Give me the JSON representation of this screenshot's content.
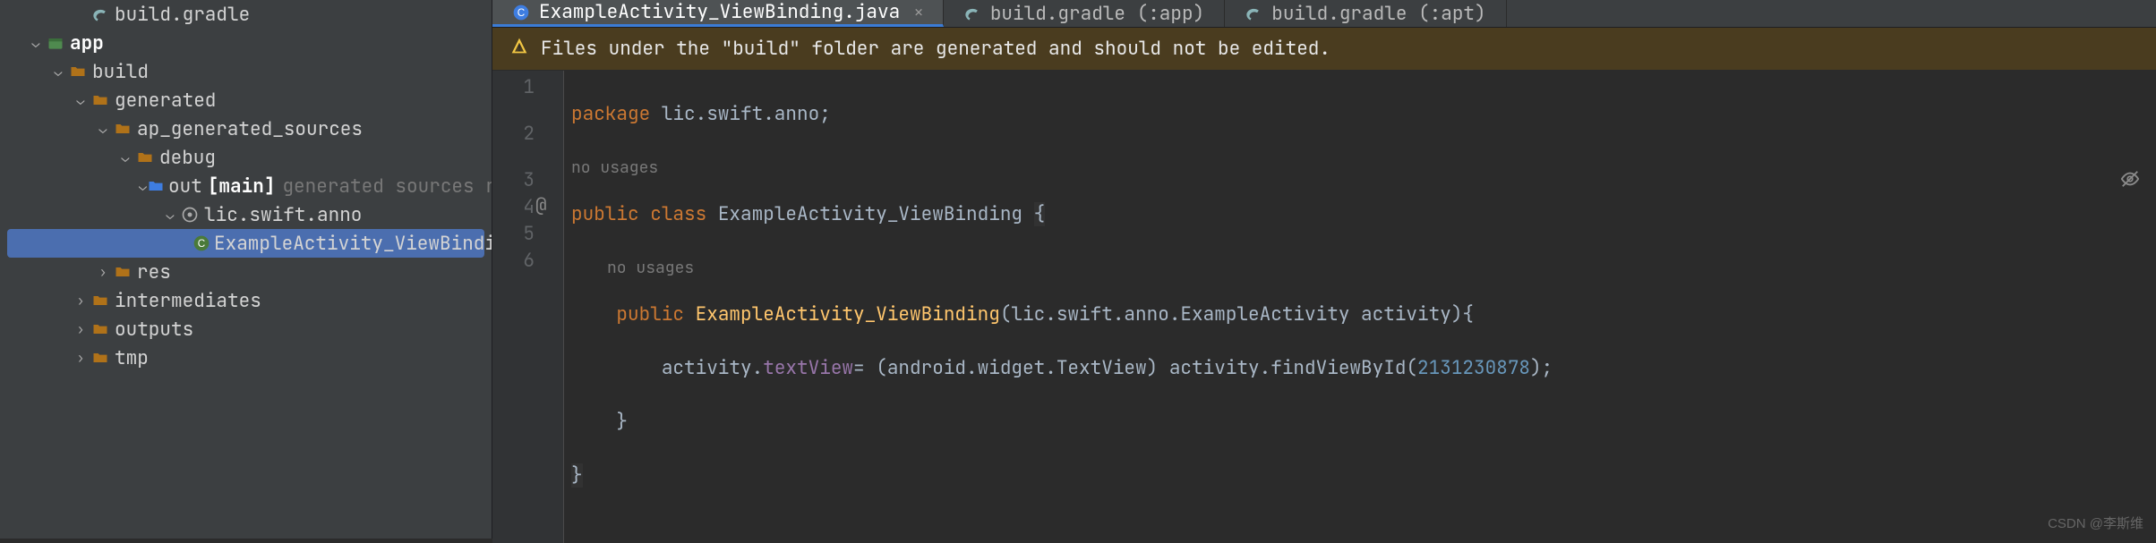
{
  "tree": {
    "n0": "build.gradle",
    "n1": "app",
    "n2": "build",
    "n3": "generated",
    "n4": "ap_generated_sources",
    "n5": "debug",
    "n6": "out",
    "n6_bold": "[main]",
    "n6_dim": "generated sources root",
    "n7": "lic.swift.anno",
    "n8": "ExampleActivity_ViewBinding",
    "n9": "res",
    "n10": "intermediates",
    "n11": "outputs",
    "n12": "tmp"
  },
  "tabs": {
    "t0": "ExampleActivity_ViewBinding.java",
    "t1": "build.gradle (:app)",
    "t2": "build.gradle (:apt)"
  },
  "warning": "Files under the \"build\" folder are generated and should not be edited.",
  "code": {
    "hint": "no usages",
    "l1_kw": "package",
    "l1_rest": " lic.swift.anno;",
    "l2_kw1": "public",
    "l2_kw2": "class",
    "l2_name": "ExampleActivity_ViewBinding",
    "l2_brace": "{",
    "l3_kw": "public",
    "l3_ctor": "ExampleActivity_ViewBinding",
    "l3_params": "(lic.swift.anno.ExampleActivity activity){",
    "l4_a": "activity.",
    "l4_field": "textView",
    "l4_b": "= (android.widget.TextView) activity.findViewById(",
    "l4_num": "2131230878",
    "l4_c": ");",
    "l5": "}",
    "l6": "}",
    "gutter": {
      "g1": "1",
      "g2": "2",
      "g3": "3",
      "g4": "4",
      "g5": "5",
      "g6": "6",
      "at": "@"
    }
  },
  "watermark": "CSDN @李斯维"
}
